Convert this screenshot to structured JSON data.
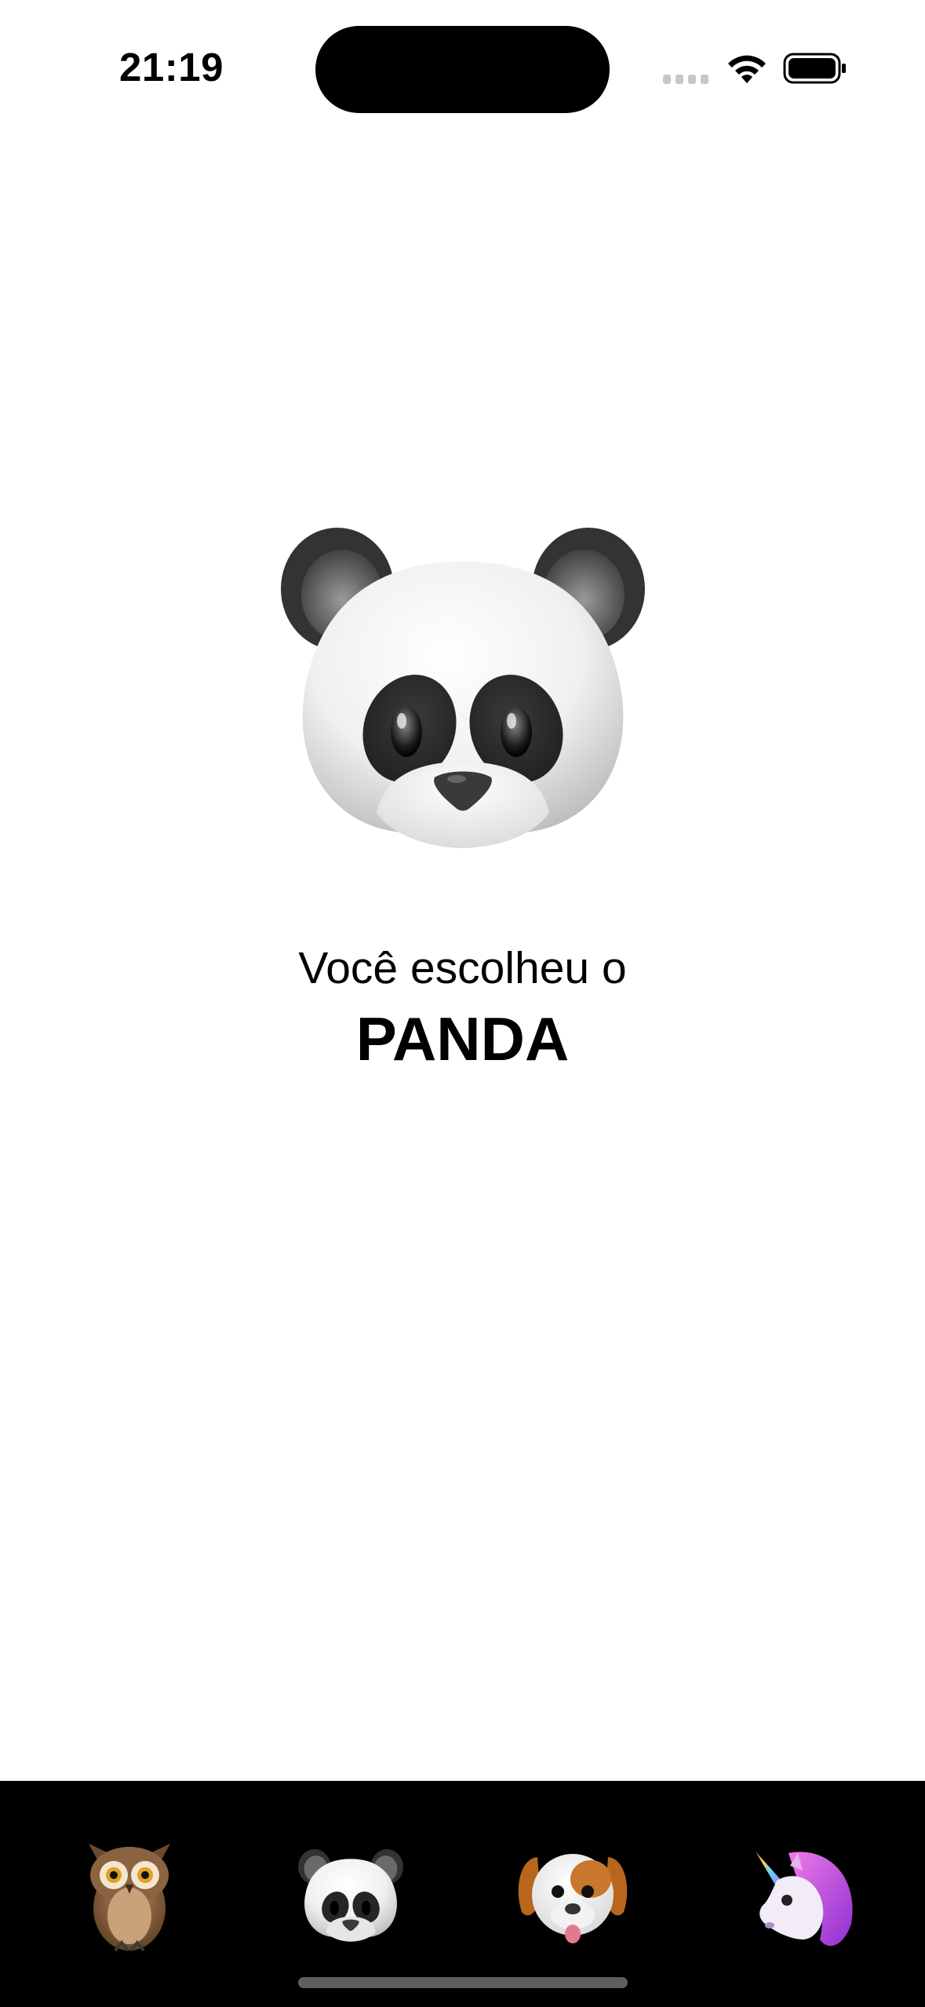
{
  "status_bar": {
    "time": "21:19"
  },
  "selection": {
    "prefix": "Você escolheu o",
    "animal": "PANDA",
    "hero_icon": "panda-face-icon"
  },
  "tab_bar": {
    "tabs": [
      {
        "icon": "owl-icon"
      },
      {
        "icon": "panda-face-icon",
        "selected": true
      },
      {
        "icon": "dog-face-icon"
      },
      {
        "icon": "unicorn-icon"
      }
    ]
  },
  "colors": {
    "background": "#ffffff",
    "tab_bar_background": "#000000",
    "text": "#000000"
  }
}
